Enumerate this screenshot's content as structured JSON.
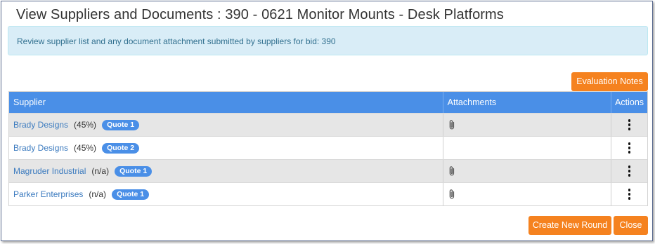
{
  "modal": {
    "title": "View Suppliers and Documents : 390 - 0621 Monitor Mounts - Desk Platforms",
    "info_text": "Review supplier list and any document attachment submitted by suppliers for bid: 390"
  },
  "buttons": {
    "evaluation_notes": "Evaluation Notes",
    "create_new_round": "Create New Round",
    "close": "Close"
  },
  "table": {
    "headers": {
      "supplier": "Supplier",
      "attachments": "Attachments",
      "actions": "Actions"
    },
    "rows": [
      {
        "supplier": "Brady Designs",
        "score": "(45%)",
        "quote": "Quote 1",
        "has_attachment": true
      },
      {
        "supplier": "Brady Designs",
        "score": "(45%)",
        "quote": "Quote 2",
        "has_attachment": false
      },
      {
        "supplier": "Magruder Industrial",
        "score": "(n/a)",
        "quote": "Quote 1",
        "has_attachment": true
      },
      {
        "supplier": "Parker Enterprises",
        "score": "(n/a)",
        "quote": "Quote 1",
        "has_attachment": true
      }
    ]
  },
  "icons": {
    "attachment": "paperclip-icon",
    "actions": "vertical-ellipsis-icon"
  },
  "colors": {
    "accent_orange": "#f5821f",
    "header_blue": "#4a8fe7",
    "link_blue": "#3c7bbf",
    "info_bg": "#d9edf7"
  }
}
